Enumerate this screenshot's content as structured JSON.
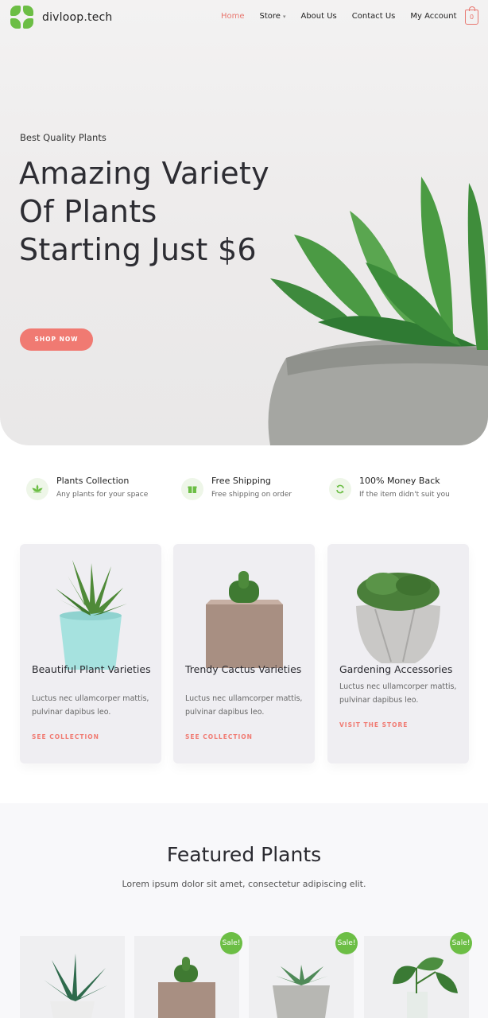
{
  "header": {
    "logo_text": "divloop.tech",
    "nav": [
      "Home",
      "Store",
      "About Us",
      "Contact Us",
      "My Account"
    ],
    "cart_count": "0"
  },
  "hero": {
    "eyebrow": "Best Quality Plants",
    "title": "Amazing Variety Of Plants Starting Just $6",
    "button": "SHOP NOW"
  },
  "features": [
    {
      "title": "Plants Collection",
      "sub": "Any plants for your space",
      "icon": "lotus-icon"
    },
    {
      "title": "Free Shipping",
      "sub": "Free shipping on order",
      "icon": "gift-icon"
    },
    {
      "title": "100% Money Back",
      "sub": "If the item didn't suit you",
      "icon": "refresh-icon"
    }
  ],
  "cards": [
    {
      "title": "Beautiful Plant Varieties",
      "text": "Luctus nec ullamcorper mattis, pulvinar dapibus leo.",
      "link": "SEE COLLECTION"
    },
    {
      "title": "Trendy Cactus Varieties",
      "text": "Luctus nec ullamcorper mattis, pulvinar dapibus leo.",
      "link": "SEE COLLECTION"
    },
    {
      "title": "Gardening Accessories",
      "text": "Luctus nec ullamcorper mattis, pulvinar dapibus leo.",
      "link": "VISIT THE STORE"
    }
  ],
  "featured": {
    "title": "Featured Plants",
    "subtitle": "Lorem ipsum dolor sit amet, consectetur adipiscing elit.",
    "sale_badge": "Sale!"
  },
  "colors": {
    "accent": "#f07a72",
    "brand_green": "#6cbe45"
  }
}
